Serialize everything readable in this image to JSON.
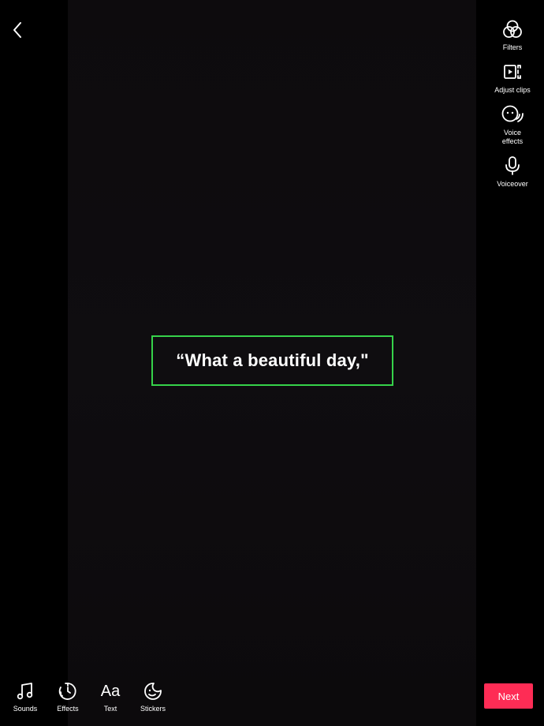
{
  "header": {
    "back_icon": "chevron-left-icon"
  },
  "right_toolbar": {
    "filters": {
      "label": "Filters",
      "icon": "filters-icon"
    },
    "adjust_clips": {
      "label": "Adjust clips",
      "icon": "adjust-clips-icon"
    },
    "voice_effects": {
      "label": "Voice effects",
      "icon": "voice-effects-icon"
    },
    "voiceover": {
      "label": "Voiceover",
      "icon": "microphone-icon"
    }
  },
  "canvas": {
    "text_overlay": "“What a beautiful day,\"",
    "highlight_color": "#36d24a"
  },
  "bottom_toolbar": {
    "sounds": {
      "label": "Sounds",
      "icon": "music-note-icon"
    },
    "effects": {
      "label": "Effects",
      "icon": "effects-timer-icon"
    },
    "text": {
      "label": "Text",
      "icon": "text-aa-icon",
      "glyph": "Aa"
    },
    "stickers": {
      "label": "Stickers",
      "icon": "sticker-icon"
    }
  },
  "next_button": {
    "label": "Next",
    "color": "#fe2c55"
  }
}
